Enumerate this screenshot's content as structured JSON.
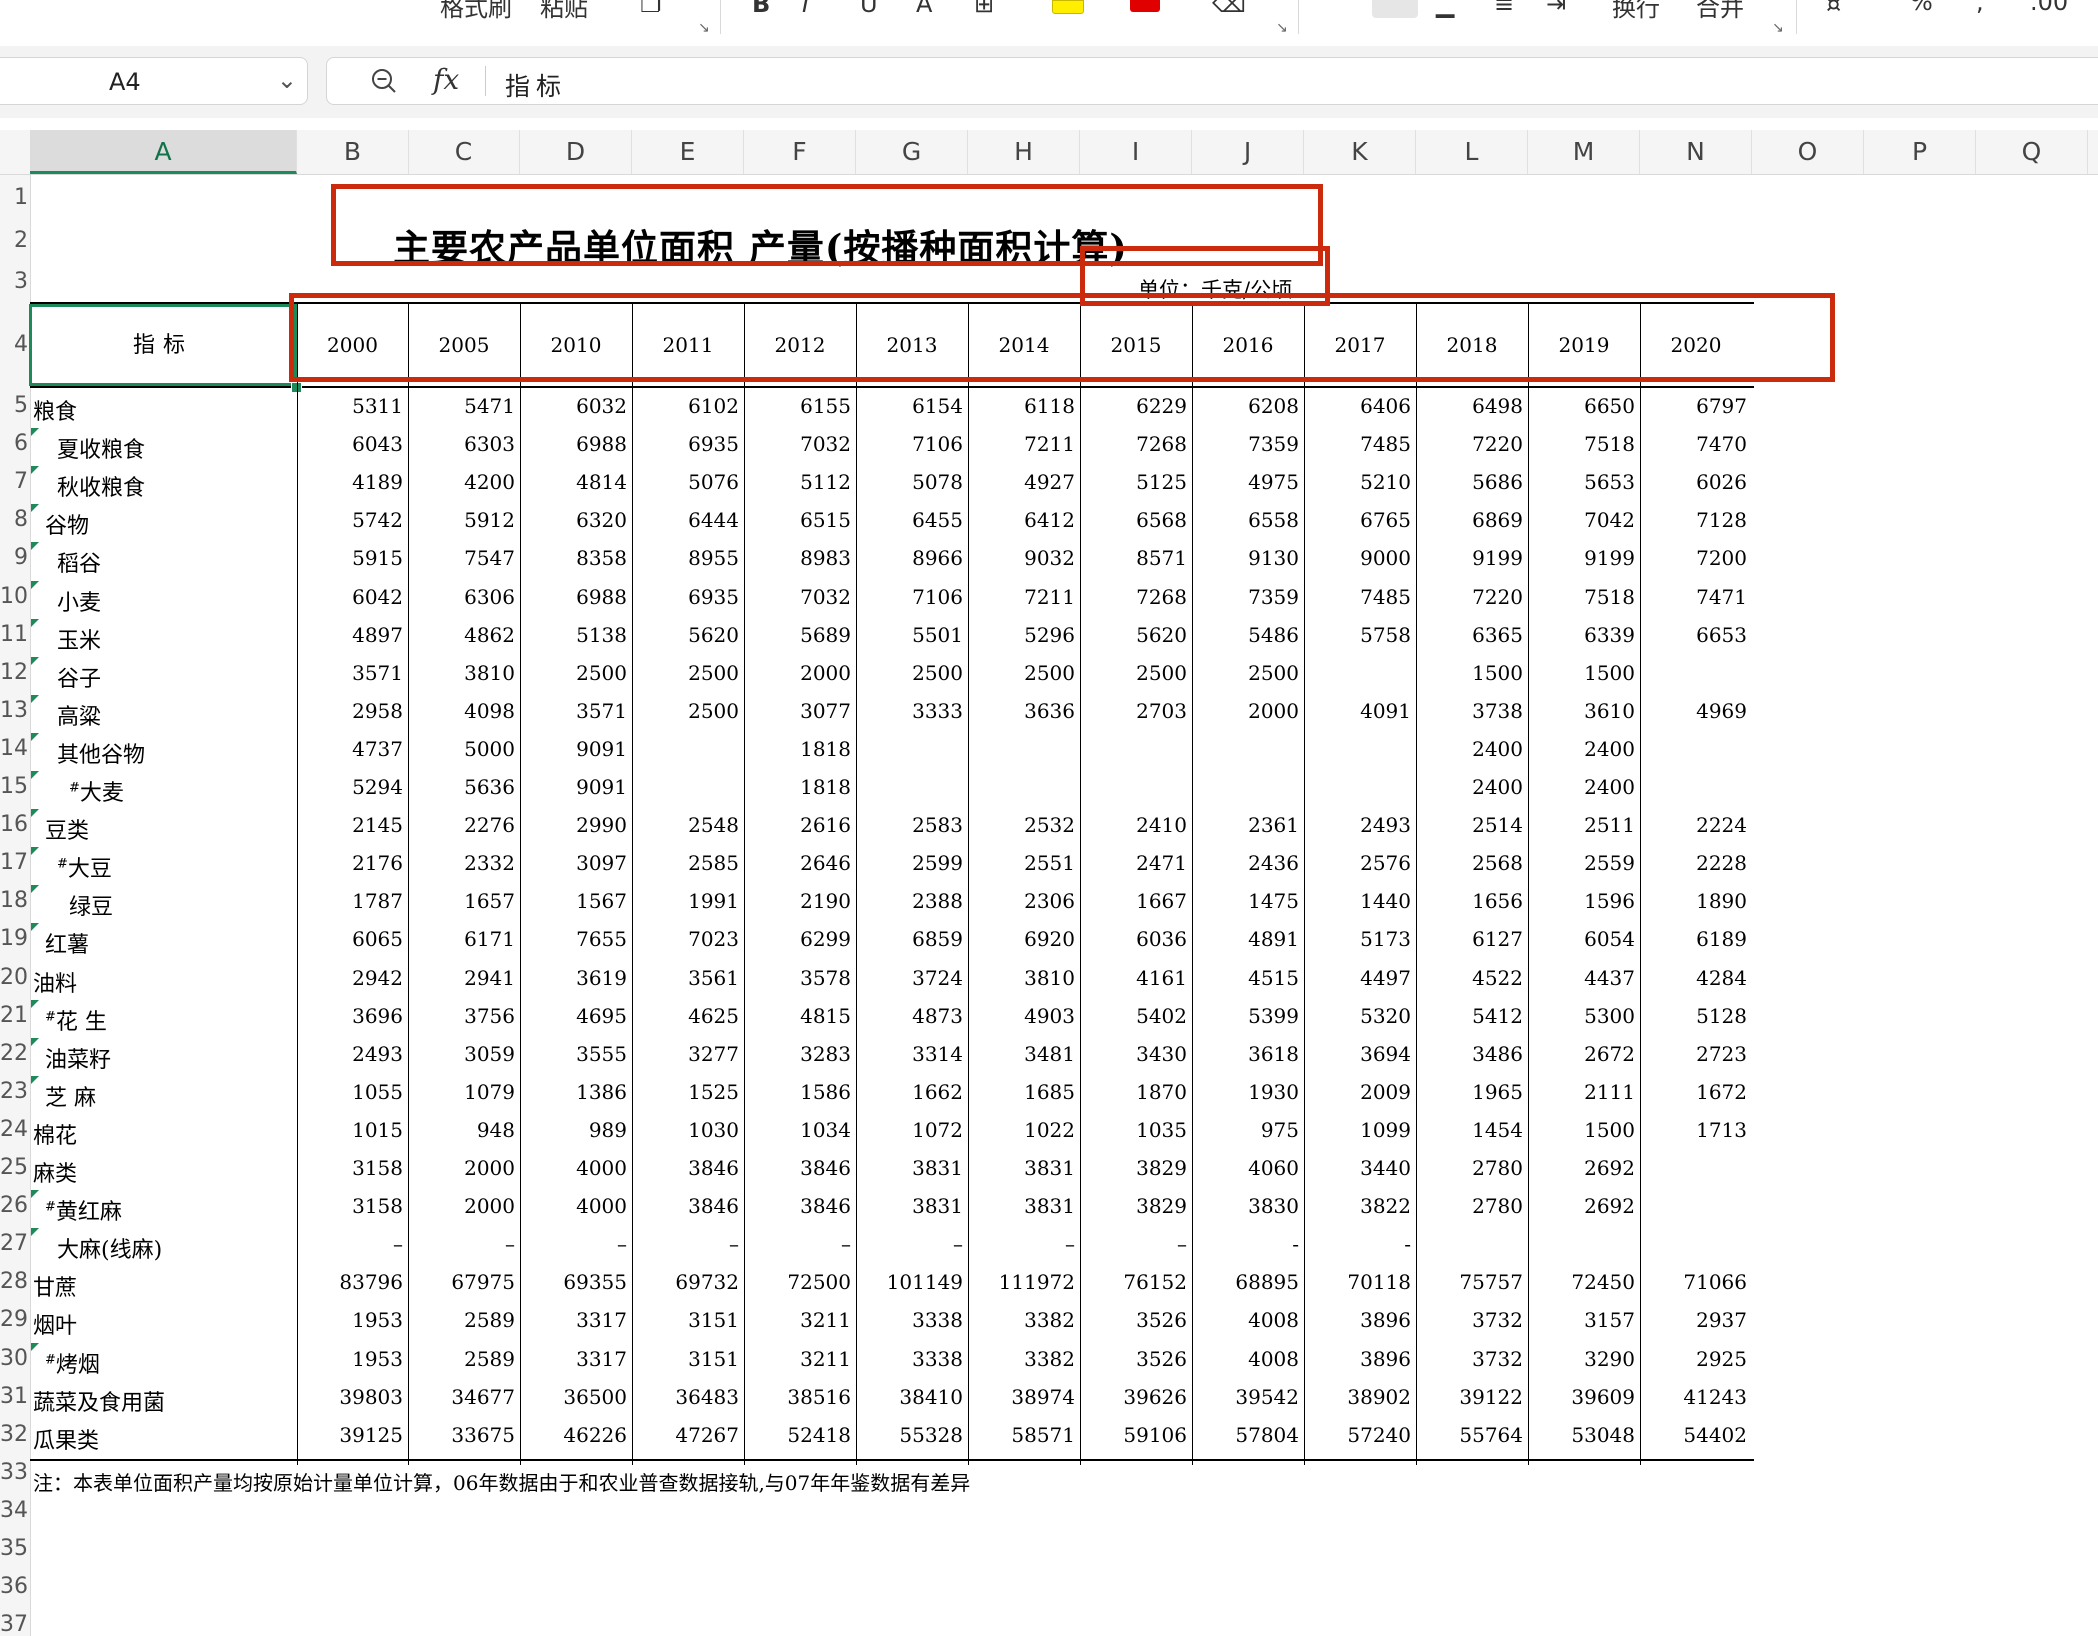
{
  "ribbon": {
    "format_painter_label": "格式刷",
    "paste_label": "粘贴",
    "wrap_label": "换行",
    "merge_label": "合并",
    "percent_label": "%",
    "comma_label": ",",
    "decimal_label": ".00",
    "highlight_color": "#ffee00",
    "font_color": "#e00000"
  },
  "formula_bar": {
    "cell_ref": "A4",
    "fx_label": "fx",
    "content": "指标"
  },
  "grid": {
    "selected_column": "A",
    "columns": [
      "A",
      "B",
      "C",
      "D",
      "E",
      "F",
      "G",
      "H",
      "I",
      "J",
      "K",
      "L",
      "M",
      "N",
      "O",
      "P",
      "Q"
    ],
    "row_numbers": [
      "1",
      "2",
      "3",
      "4",
      "5",
      "6",
      "7",
      "8",
      "9",
      "10",
      "11",
      "12",
      "13",
      "14",
      "15",
      "16",
      "17",
      "18",
      "19",
      "20",
      "21",
      "22",
      "23",
      "24",
      "25",
      "26",
      "27",
      "28",
      "29",
      "30",
      "31",
      "32",
      "33",
      "34",
      "35",
      "36",
      "37"
    ]
  },
  "sheet": {
    "title": "主要农产品单位面积 产量(按播种面积计算)",
    "unit": "单位：千克/公顷",
    "header_label": "指标",
    "years": [
      "2000",
      "2005",
      "2010",
      "2011",
      "2012",
      "2013",
      "2014",
      "2015",
      "2016",
      "2017",
      "2018",
      "2019",
      "2020"
    ],
    "rows": [
      {
        "label": "粮食",
        "indent": 0,
        "mark": "",
        "values": [
          "5311",
          "5471",
          "6032",
          "6102",
          "6155",
          "6154",
          "6118",
          "6229",
          "6208",
          "6406",
          "6498",
          "6650",
          "6797"
        ]
      },
      {
        "label": "夏收粮食",
        "indent": 2,
        "mark": "",
        "values": [
          "6043",
          "6303",
          "6988",
          "6935",
          "7032",
          "7106",
          "7211",
          "7268",
          "7359",
          "7485",
          "7220",
          "7518",
          "7470"
        ]
      },
      {
        "label": "秋收粮食",
        "indent": 2,
        "mark": "",
        "values": [
          "4189",
          "4200",
          "4814",
          "5076",
          "5112",
          "5078",
          "4927",
          "5125",
          "4975",
          "5210",
          "5686",
          "5653",
          "6026"
        ]
      },
      {
        "label": "谷物",
        "indent": 1,
        "mark": "",
        "values": [
          "5742",
          "5912",
          "6320",
          "6444",
          "6515",
          "6455",
          "6412",
          "6568",
          "6558",
          "6765",
          "6869",
          "7042",
          "7128"
        ]
      },
      {
        "label": "稻谷",
        "indent": 2,
        "mark": "",
        "values": [
          "5915",
          "7547",
          "8358",
          "8955",
          "8983",
          "8966",
          "9032",
          "8571",
          "9130",
          "9000",
          "9199",
          "9199",
          "7200"
        ]
      },
      {
        "label": "小麦",
        "indent": 2,
        "mark": "",
        "values": [
          "6042",
          "6306",
          "6988",
          "6935",
          "7032",
          "7106",
          "7211",
          "7268",
          "7359",
          "7485",
          "7220",
          "7518",
          "7471"
        ]
      },
      {
        "label": "玉米",
        "indent": 2,
        "mark": "",
        "values": [
          "4897",
          "4862",
          "5138",
          "5620",
          "5689",
          "5501",
          "5296",
          "5620",
          "5486",
          "5758",
          "6365",
          "6339",
          "6653"
        ]
      },
      {
        "label": "谷子",
        "indent": 2,
        "mark": "",
        "values": [
          "3571",
          "3810",
          "2500",
          "2500",
          "2000",
          "2500",
          "2500",
          "2500",
          "2500",
          "",
          "1500",
          "1500",
          ""
        ]
      },
      {
        "label": "高粱",
        "indent": 2,
        "mark": "",
        "values": [
          "2958",
          "4098",
          "3571",
          "2500",
          "3077",
          "3333",
          "3636",
          "2703",
          "2000",
          "4091",
          "3738",
          "3610",
          "4969"
        ]
      },
      {
        "label": "其他谷物",
        "indent": 2,
        "mark": "",
        "values": [
          "4737",
          "5000",
          "9091",
          "",
          "1818",
          "",
          "",
          "",
          "",
          "",
          "2400",
          "2400",
          ""
        ]
      },
      {
        "label": "大麦",
        "indent": 3,
        "mark": "#",
        "values": [
          "5294",
          "5636",
          "9091",
          "",
          "1818",
          "",
          "",
          "",
          "",
          "",
          "2400",
          "2400",
          ""
        ]
      },
      {
        "label": "豆类",
        "indent": 1,
        "mark": "",
        "values": [
          "2145",
          "2276",
          "2990",
          "2548",
          "2616",
          "2583",
          "2532",
          "2410",
          "2361",
          "2493",
          "2514",
          "2511",
          "2224"
        ]
      },
      {
        "label": "大豆",
        "indent": 2,
        "mark": "#",
        "values": [
          "2176",
          "2332",
          "3097",
          "2585",
          "2646",
          "2599",
          "2551",
          "2471",
          "2436",
          "2576",
          "2568",
          "2559",
          "2228"
        ]
      },
      {
        "label": "绿豆",
        "indent": 3,
        "mark": "",
        "values": [
          "1787",
          "1657",
          "1567",
          "1991",
          "2190",
          "2388",
          "2306",
          "1667",
          "1475",
          "1440",
          "1656",
          "1596",
          "1890"
        ]
      },
      {
        "label": "红薯",
        "indent": 1,
        "mark": "",
        "values": [
          "6065",
          "6171",
          "7655",
          "7023",
          "6299",
          "6859",
          "6920",
          "6036",
          "4891",
          "5173",
          "6127",
          "6054",
          "6189"
        ]
      },
      {
        "label": "油料",
        "indent": 0,
        "mark": "",
        "values": [
          "2942",
          "2941",
          "3619",
          "3561",
          "3578",
          "3724",
          "3810",
          "4161",
          "4515",
          "4497",
          "4522",
          "4437",
          "4284"
        ]
      },
      {
        "label": "花 生",
        "indent": 1,
        "mark": "#",
        "values": [
          "3696",
          "3756",
          "4695",
          "4625",
          "4815",
          "4873",
          "4903",
          "5402",
          "5399",
          "5320",
          "5412",
          "5300",
          "5128"
        ]
      },
      {
        "label": "油菜籽",
        "indent": 1,
        "mark": "",
        "values": [
          "2493",
          "3059",
          "3555",
          "3277",
          "3283",
          "3314",
          "3481",
          "3430",
          "3618",
          "3694",
          "3486",
          "2672",
          "2723"
        ]
      },
      {
        "label": "芝 麻",
        "indent": 1,
        "mark": "",
        "values": [
          "1055",
          "1079",
          "1386",
          "1525",
          "1586",
          "1662",
          "1685",
          "1870",
          "1930",
          "2009",
          "1965",
          "2111",
          "1672"
        ]
      },
      {
        "label": "棉花",
        "indent": 0,
        "mark": "",
        "values": [
          "1015",
          "948",
          "989",
          "1030",
          "1034",
          "1072",
          "1022",
          "1035",
          "975",
          "1099",
          "1454",
          "1500",
          "1713"
        ]
      },
      {
        "label": "麻类",
        "indent": 0,
        "mark": "",
        "values": [
          "3158",
          "2000",
          "4000",
          "3846",
          "3846",
          "3831",
          "3831",
          "3829",
          "4060",
          "3440",
          "2780",
          "2692",
          ""
        ]
      },
      {
        "label": "黄红麻",
        "indent": 1,
        "mark": "#",
        "values": [
          "3158",
          "2000",
          "4000",
          "3846",
          "3846",
          "3831",
          "3831",
          "3829",
          "3830",
          "3822",
          "2780",
          "2692",
          ""
        ]
      },
      {
        "label": "大麻(线麻)",
        "indent": 2,
        "mark": "",
        "values": [
          "–",
          "–",
          "–",
          "–",
          "–",
          "–",
          "–",
          "–",
          "-",
          "-",
          "",
          "",
          ""
        ]
      },
      {
        "label": "甘蔗",
        "indent": 0,
        "mark": "",
        "values": [
          "83796",
          "67975",
          "69355",
          "69732",
          "72500",
          "101149",
          "111972",
          "76152",
          "68895",
          "70118",
          "75757",
          "72450",
          "71066"
        ]
      },
      {
        "label": "烟叶",
        "indent": 0,
        "mark": "",
        "values": [
          "1953",
          "2589",
          "3317",
          "3151",
          "3211",
          "3338",
          "3382",
          "3526",
          "4008",
          "3896",
          "3732",
          "3157",
          "2937"
        ]
      },
      {
        "label": "烤烟",
        "indent": 1,
        "mark": "#",
        "values": [
          "1953",
          "2589",
          "3317",
          "3151",
          "3211",
          "3338",
          "3382",
          "3526",
          "4008",
          "3896",
          "3732",
          "3290",
          "2925"
        ]
      },
      {
        "label": "蔬菜及食用菌",
        "indent": 0,
        "mark": "",
        "values": [
          "39803",
          "34677",
          "36500",
          "36483",
          "38516",
          "38410",
          "38974",
          "39626",
          "39542",
          "38902",
          "39122",
          "39609",
          "41243"
        ]
      },
      {
        "label": "瓜果类",
        "indent": 0,
        "mark": "",
        "values": [
          "39125",
          "33675",
          "46226",
          "47267",
          "52418",
          "55328",
          "58571",
          "59106",
          "57804",
          "57240",
          "55764",
          "53048",
          "54402"
        ]
      }
    ],
    "note": "注：本表单位面积产量均按原始计量单位计算，06年数据由于和农业普查数据接轨,与07年年鉴数据有差异"
  },
  "annotation_color": "#cc2a0c"
}
